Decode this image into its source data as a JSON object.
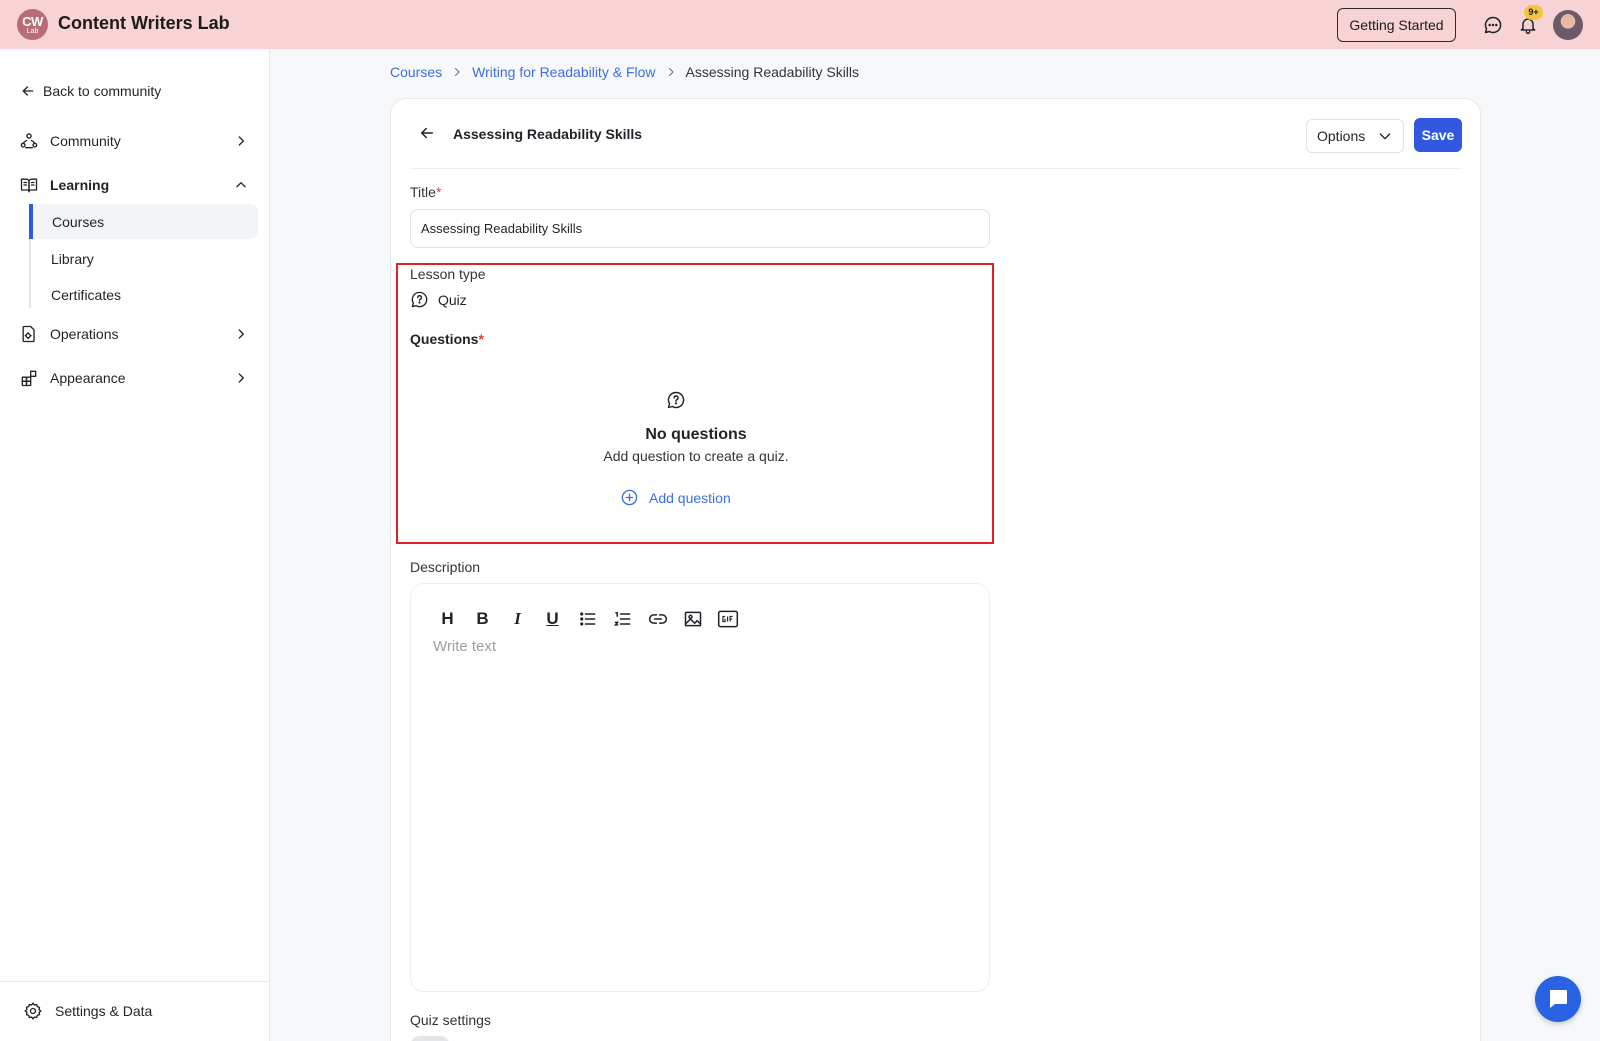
{
  "app": {
    "logo_text_top": "CW",
    "logo_text_bottom": "Lab",
    "name": "Content Writers Lab"
  },
  "topbar": {
    "getting_started_label": "Getting Started",
    "notification_count": "9+"
  },
  "sidebar": {
    "back_label": "Back to community",
    "items": [
      {
        "label": "Community",
        "icon": "community-icon",
        "expanded": false
      },
      {
        "label": "Learning",
        "icon": "book-open-icon",
        "expanded": true
      },
      {
        "label": "Operations",
        "icon": "operations-icon",
        "expanded": false
      },
      {
        "label": "Appearance",
        "icon": "appearance-icon",
        "expanded": false
      }
    ],
    "learning_subitems": [
      {
        "label": "Courses",
        "active": true
      },
      {
        "label": "Library",
        "active": false
      },
      {
        "label": "Certificates",
        "active": false
      }
    ],
    "settings_label": "Settings & Data"
  },
  "breadcrumb": {
    "items": [
      "Courses",
      "Writing for Readability & Flow"
    ],
    "current": "Assessing Readability Skills"
  },
  "editor": {
    "header_title": "Assessing Readability Skills",
    "options_label": "Options",
    "save_label": "Save",
    "title_label": "Title",
    "required_mark": "*",
    "title_value": "Assessing Readability Skills",
    "lesson_type_label": "Lesson type",
    "lesson_type_value": "Quiz",
    "questions_label": "Questions",
    "empty_title": "No questions",
    "empty_subtitle": "Add question to create a quiz.",
    "add_question_label": "Add question",
    "description_label": "Description",
    "description_placeholder": "Write text",
    "toolbar": [
      "heading",
      "bold",
      "italic",
      "underline",
      "bullet-list",
      "numbered-list",
      "link",
      "image",
      "gif"
    ],
    "toolbar_glyphs": {
      "heading": "H",
      "bold": "B",
      "italic": "I",
      "underline": "U"
    },
    "quiz_settings_label": "Quiz settings"
  },
  "colors": {
    "topbar_bg": "#f7d3d6",
    "accent": "#3358e0",
    "link": "#3b6fe0",
    "highlight_border": "#d9252a",
    "badge": "#f5c542"
  }
}
